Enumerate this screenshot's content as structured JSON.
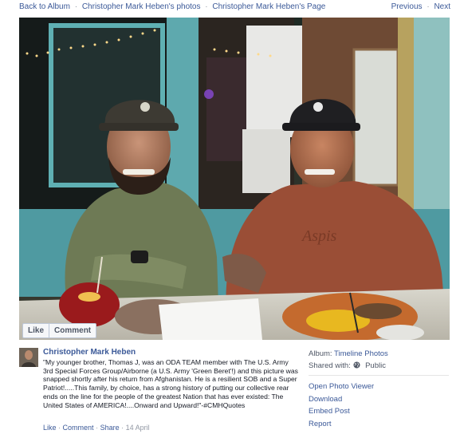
{
  "nav": {
    "back_to_album": "Back to Album",
    "photos_link": "Christopher Mark Heben's photos",
    "page_link": "Christopher Mark Heben's Page",
    "separator": "·",
    "previous": "Previous",
    "next": "Next"
  },
  "photo_actions": {
    "like": "Like",
    "comment": "Comment"
  },
  "post": {
    "author": "Christopher Mark Heben",
    "text": "\"My younger brother, Thomas J, was an ODA TEAM member with The U.S. Army 3rd Special Forces Group/Airborne (a U.S. Army 'Green Beret'!) and this picture was snapped shortly after his return from Afghanistan. He is a resilient SOB and a Super Patriot!.....This family, by choice, has a strong history of putting our collective rear ends on the line for the people of the greatest Nation that has ever existed: The United States of AMERICA!....Onward and Upward!\"-#CMHQuotes",
    "like": "Like",
    "comment": "Comment",
    "share": "Share",
    "date": "14 April"
  },
  "info": {
    "album_label": "Album:",
    "album_value": "Timeline Photos",
    "shared_label": "Shared with:",
    "shared_value": "Public",
    "shared_icon": "globe-icon",
    "actions": [
      "Open Photo Viewer",
      "Download",
      "Embed Post",
      "Report"
    ]
  },
  "colors": {
    "link": "#3b5998",
    "muted": "#9197a3",
    "text": "#141823"
  }
}
